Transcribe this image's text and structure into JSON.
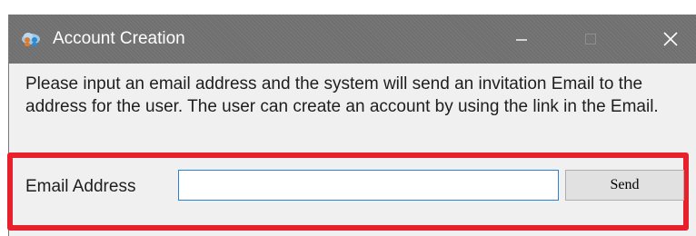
{
  "window": {
    "title": "Account Creation",
    "app_icon": "cloud-people-icon",
    "controls": {
      "minimize_icon": "minimize-icon",
      "maximize_icon": "maximize-icon",
      "close_icon": "close-icon"
    }
  },
  "dialog": {
    "message": "Please input an email address and the system will send an invitation Email to the address for the user. The user can create an account by using the link in the Email.",
    "email_label": "Email Address",
    "email_value": "",
    "email_placeholder": "",
    "send_label": "Send"
  },
  "colors": {
    "titlebar": "#707070",
    "dialog_background": "#f0f0f0",
    "highlight_border": "#e8202b",
    "input_focus_border": "#2b7fd4"
  }
}
